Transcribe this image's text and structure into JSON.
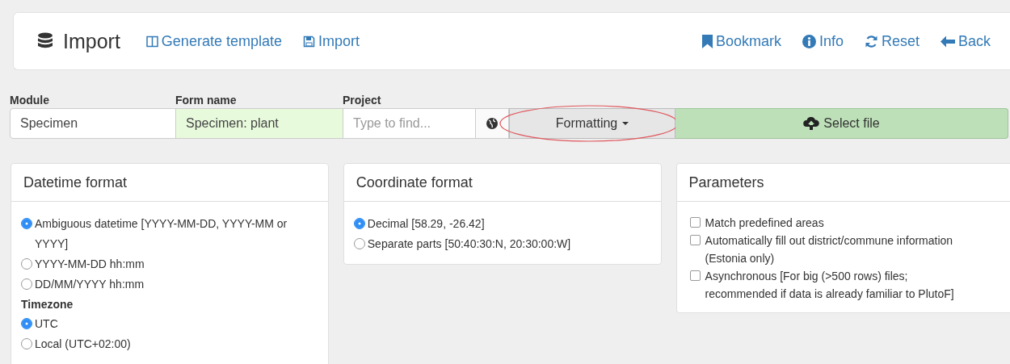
{
  "header": {
    "title": "Import",
    "left_links": [
      {
        "label": "Generate template"
      },
      {
        "label": "Import"
      }
    ],
    "right_links": [
      {
        "label": "Bookmark"
      },
      {
        "label": "Info"
      },
      {
        "label": "Reset"
      },
      {
        "label": "Back"
      }
    ]
  },
  "form": {
    "fields": [
      {
        "label": "Module",
        "value": "Specimen",
        "valid": false
      },
      {
        "label": "Form name",
        "value": "Specimen: plant",
        "valid": true
      },
      {
        "label": "Project",
        "placeholder": "Type to find..."
      }
    ],
    "formatting_button": "Formatting",
    "formatting_highlighted": true,
    "select_file_button": "Select file"
  },
  "panels": [
    {
      "title": "Datetime format",
      "items": [
        {
          "kind": "radio",
          "label": "Ambiguous datetime [YYYY-MM-DD, YYYY-MM or YYYY]",
          "selected": true
        },
        {
          "kind": "radio",
          "label": "YYYY-MM-DD hh:mm",
          "selected": false
        },
        {
          "kind": "radio",
          "label": "DD/MM/YYYY hh:mm",
          "selected": false
        },
        {
          "kind": "heading",
          "label": "Timezone"
        },
        {
          "kind": "radio",
          "label": "UTC",
          "selected": true
        },
        {
          "kind": "radio",
          "label": "Local (UTC+02:00)",
          "selected": false
        }
      ]
    },
    {
      "title": "Coordinate format",
      "items": [
        {
          "kind": "radio",
          "label": "Decimal [58.29, -26.42]",
          "selected": true
        },
        {
          "kind": "radio",
          "label": "Separate parts [50:40:30:N, 20:30:00:W]",
          "selected": false
        }
      ]
    },
    {
      "title": "Parameters",
      "items": [
        {
          "kind": "checkbox",
          "label": "Match predefined areas",
          "checked": false
        },
        {
          "kind": "checkbox",
          "label": "Automatically fill out district/commune information (Estonia only)",
          "checked": false
        },
        {
          "kind": "checkbox",
          "label": "Asynchronous [For big (>500 rows) files; recommended if data is already familiar to PlutoF]",
          "checked": false
        }
      ]
    }
  ]
}
